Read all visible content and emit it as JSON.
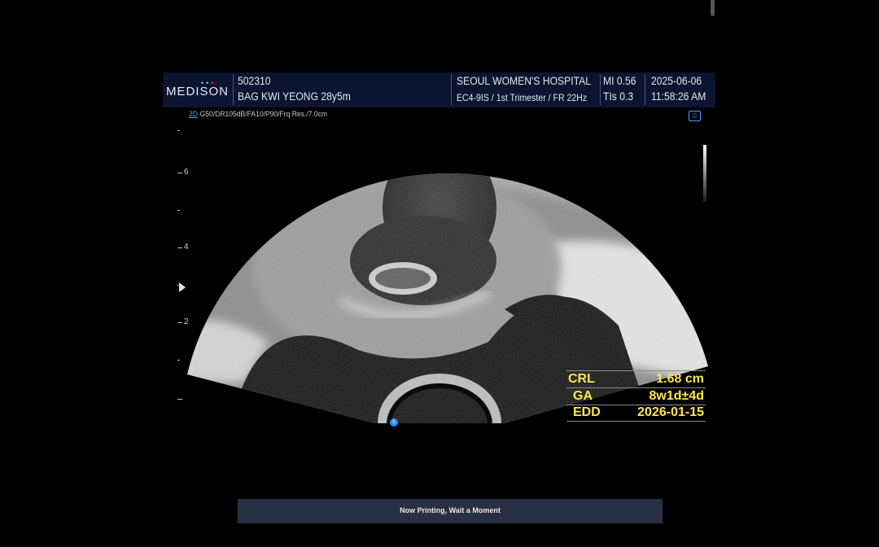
{
  "header": {
    "logo": "MEDISON",
    "patient_id": "502310",
    "patient_name": "BAG KWI YEONG 28y5m",
    "hospital": "SEOUL WOMEN'S HOSPITAL",
    "probe_info": "EC4-9IS / 1st Trimester / FR 22Hz",
    "mi": "MI  0.56",
    "tis": "TIs  0.3",
    "date": "2025-06-06",
    "time": "11:58:26 AM"
  },
  "imaging_params": {
    "mode": "2D",
    "settings": "G50/DR105dB/FA10/P90/Frq Res./7.0cm"
  },
  "depth_scale": {
    "labels": [
      "6",
      "4",
      "2"
    ]
  },
  "measurements": [
    {
      "label": "CRL",
      "value": "1.68 cm"
    },
    {
      "label": "GA",
      "value": "8w1d±4d"
    },
    {
      "label": "EDD",
      "value": "2026-01-15"
    }
  ],
  "status": {
    "message": "Now Printing, Wait a Moment"
  },
  "markers": {
    "focus": "s",
    "probe_badge": "◫"
  },
  "colors": {
    "header_bg": "#0b1430",
    "measurement_text": "#ffe84a",
    "accent_blue": "#4aa0ff",
    "status_bar_bg": "#2a3043"
  }
}
